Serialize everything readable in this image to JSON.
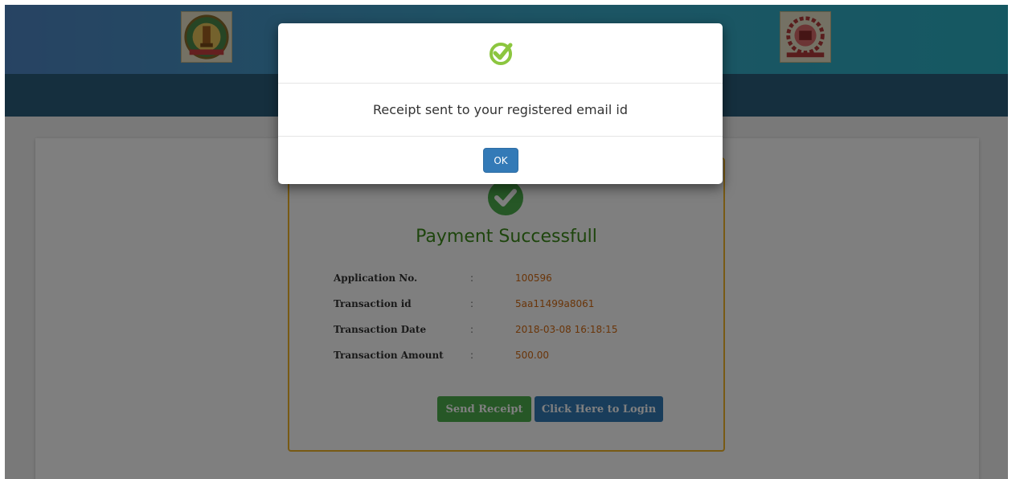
{
  "header": {
    "left_emblem_icon": "tamil-nadu-emblem",
    "right_emblem_icon": "anna-university-logo"
  },
  "payment": {
    "title": "Payment Successfull",
    "details": [
      {
        "label": "Application No.",
        "separator": ":",
        "value": "100596"
      },
      {
        "label": "Transaction id",
        "separator": ":",
        "value": "5aa11499a8061"
      },
      {
        "label": "Transaction Date",
        "separator": ":",
        "value": "2018-03-08 16:18:15"
      },
      {
        "label": "Transaction Amount",
        "separator": ":",
        "value": "500.00"
      }
    ],
    "send_receipt_label": "Send Receipt",
    "login_label": "Click Here to Login"
  },
  "modal": {
    "icon": "check-circle-icon",
    "message": "Receipt sent to your registered email id",
    "ok_label": "OK"
  },
  "colors": {
    "success_green": "#3c8b1a",
    "value_orange": "#d46a12",
    "box_border": "#f0b429",
    "primary_blue": "#337ab7"
  }
}
